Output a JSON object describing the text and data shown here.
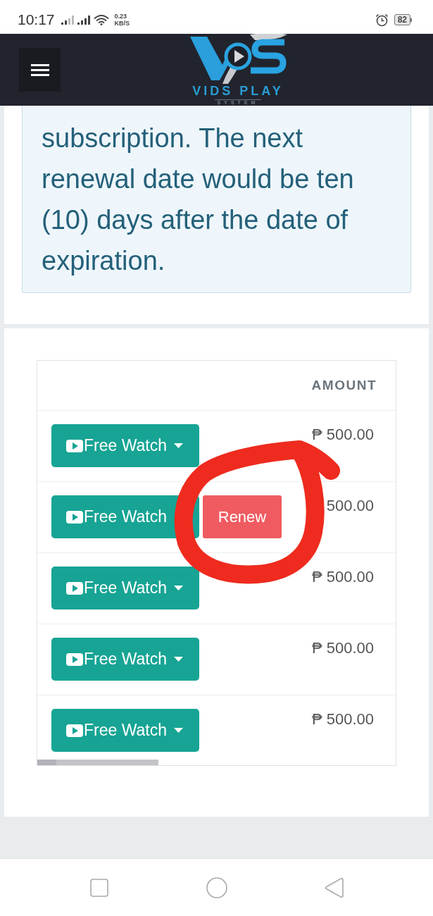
{
  "status_bar": {
    "time": "10:17",
    "network_speed": "0.23",
    "network_speed_unit": "KB/S",
    "battery": "82"
  },
  "header": {
    "logo_title": "VIDS PLAY",
    "logo_subtitle": "SYSTEM"
  },
  "notice": {
    "text": "subscription. The next renewal date would be ten (10) days after the date of expiration."
  },
  "table": {
    "amount_heading": "AMOUNT",
    "rows": [
      {
        "watch_button": "Free Watch",
        "caret": true,
        "amount": "₱ 500.00"
      },
      {
        "watch_button": "Free Watch",
        "caret": false,
        "renew_button": "Renew",
        "amount": "500.00"
      },
      {
        "watch_button": "Free Watch",
        "caret": true,
        "amount": "₱ 500.00"
      },
      {
        "watch_button": "Free Watch",
        "caret": true,
        "amount": "₱ 500.00"
      },
      {
        "watch_button": "Free Watch",
        "caret": true,
        "amount": "₱ 500.00"
      }
    ]
  }
}
